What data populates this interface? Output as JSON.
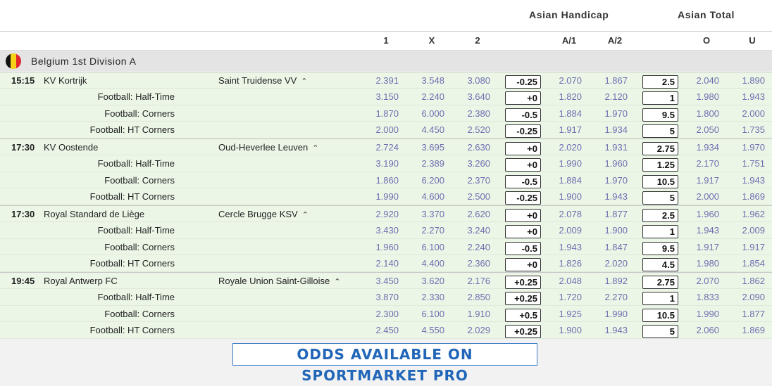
{
  "header": {
    "asian_handicap": "Asian Handicap",
    "asian_total": "Asian Total",
    "columns": [
      "1",
      "X",
      "2",
      "A/1",
      "A/2",
      "O",
      "U"
    ]
  },
  "league": {
    "name": "Belgium 1st Division A",
    "flag_colors": [
      "#111111",
      "#f7d117",
      "#e3262d"
    ]
  },
  "chevron": "⌃",
  "matches": [
    {
      "time": "15:15",
      "home": "KV Kortrijk",
      "away": "Saint Truidense VV",
      "lines": [
        {
          "label": "",
          "o1": "2.391",
          "ox": "3.548",
          "o2": "3.080",
          "ah": "-0.25",
          "a1": "2.070",
          "a2": "1.867",
          "tl": "2.5",
          "ov": "2.040",
          "un": "1.890"
        },
        {
          "label": "Football: Half-Time",
          "o1": "3.150",
          "ox": "2.240",
          "o2": "3.640",
          "ah": "+0",
          "a1": "1.820",
          "a2": "2.120",
          "tl": "1",
          "ov": "1.980",
          "un": "1.943"
        },
        {
          "label": "Football: Corners",
          "o1": "1.870",
          "ox": "6.000",
          "o2": "2.380",
          "ah": "-0.5",
          "a1": "1.884",
          "a2": "1.970",
          "tl": "9.5",
          "ov": "1.800",
          "un": "2.000"
        },
        {
          "label": "Football: HT Corners",
          "o1": "2.000",
          "ox": "4.450",
          "o2": "2.520",
          "ah": "-0.25",
          "a1": "1.917",
          "a2": "1.934",
          "tl": "5",
          "ov": "2.050",
          "un": "1.735"
        }
      ]
    },
    {
      "time": "17:30",
      "home": "KV Oostende",
      "away": "Oud-Heverlee Leuven",
      "lines": [
        {
          "label": "",
          "o1": "2.724",
          "ox": "3.695",
          "o2": "2.630",
          "ah": "+0",
          "a1": "2.020",
          "a2": "1.931",
          "tl": "2.75",
          "ov": "1.934",
          "un": "1.970"
        },
        {
          "label": "Football: Half-Time",
          "o1": "3.190",
          "ox": "2.389",
          "o2": "3.260",
          "ah": "+0",
          "a1": "1.990",
          "a2": "1.960",
          "tl": "1.25",
          "ov": "2.170",
          "un": "1.751"
        },
        {
          "label": "Football: Corners",
          "o1": "1.860",
          "ox": "6.200",
          "o2": "2.370",
          "ah": "-0.5",
          "a1": "1.884",
          "a2": "1.970",
          "tl": "10.5",
          "ov": "1.917",
          "un": "1.943"
        },
        {
          "label": "Football: HT Corners",
          "o1": "1.990",
          "ox": "4.600",
          "o2": "2.500",
          "ah": "-0.25",
          "a1": "1.900",
          "a2": "1.943",
          "tl": "5",
          "ov": "2.000",
          "un": "1.869"
        }
      ]
    },
    {
      "time": "17:30",
      "home": "Royal Standard de Liège",
      "away": "Cercle Brugge KSV",
      "lines": [
        {
          "label": "",
          "o1": "2.920",
          "ox": "3.370",
          "o2": "2.620",
          "ah": "+0",
          "a1": "2.078",
          "a2": "1.877",
          "tl": "2.5",
          "ov": "1.960",
          "un": "1.962"
        },
        {
          "label": "Football: Half-Time",
          "o1": "3.430",
          "ox": "2.270",
          "o2": "3.240",
          "ah": "+0",
          "a1": "2.009",
          "a2": "1.900",
          "tl": "1",
          "ov": "1.943",
          "un": "2.009"
        },
        {
          "label": "Football: Corners",
          "o1": "1.960",
          "ox": "6.100",
          "o2": "2.240",
          "ah": "-0.5",
          "a1": "1.943",
          "a2": "1.847",
          "tl": "9.5",
          "ov": "1.917",
          "un": "1.917"
        },
        {
          "label": "Football: HT Corners",
          "o1": "2.140",
          "ox": "4.400",
          "o2": "2.360",
          "ah": "+0",
          "a1": "1.826",
          "a2": "2.020",
          "tl": "4.5",
          "ov": "1.980",
          "un": "1.854"
        }
      ]
    },
    {
      "time": "19:45",
      "home": "Royal Antwerp FC",
      "away": "Royale Union Saint-Gilloise",
      "lines": [
        {
          "label": "",
          "o1": "3.450",
          "ox": "3.620",
          "o2": "2.176",
          "ah": "+0.25",
          "a1": "2.048",
          "a2": "1.892",
          "tl": "2.75",
          "ov": "2.070",
          "un": "1.862"
        },
        {
          "label": "Football: Half-Time",
          "o1": "3.870",
          "ox": "2.330",
          "o2": "2.850",
          "ah": "+0.25",
          "a1": "1.720",
          "a2": "2.270",
          "tl": "1",
          "ov": "1.833",
          "un": "2.090"
        },
        {
          "label": "Football: Corners",
          "o1": "2.300",
          "ox": "6.100",
          "o2": "1.910",
          "ah": "+0.5",
          "a1": "1.925",
          "a2": "1.990",
          "tl": "10.5",
          "ov": "1.990",
          "un": "1.877"
        },
        {
          "label": "Football: HT Corners",
          "o1": "2.450",
          "ox": "4.550",
          "o2": "2.029",
          "ah": "+0.25",
          "a1": "1.900",
          "a2": "1.943",
          "tl": "5",
          "ov": "2.060",
          "un": "1.869"
        }
      ]
    }
  ],
  "promo": {
    "text": "ODDS AVAILABLE ON SPORTMARKET PRO"
  }
}
